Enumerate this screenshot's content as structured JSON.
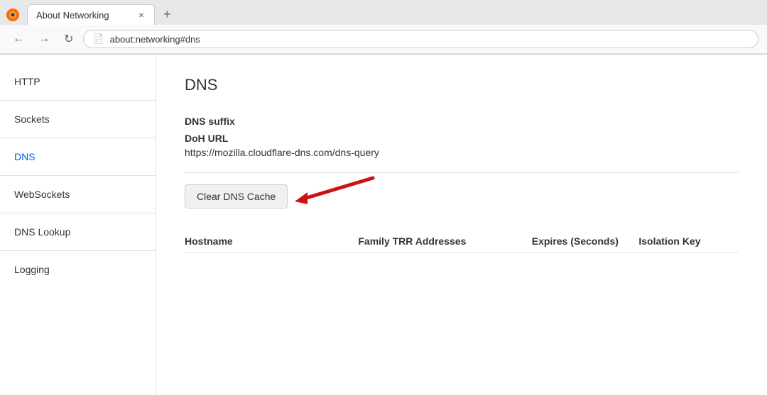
{
  "browser": {
    "tab_title": "About Networking",
    "address_url": "about:networking#dns",
    "address_icon": "🔒"
  },
  "nav": {
    "back_label": "←",
    "forward_label": "→",
    "reload_label": "↻",
    "new_tab_label": "+"
  },
  "sidebar": {
    "items": [
      {
        "id": "http",
        "label": "HTTP",
        "active": false
      },
      {
        "id": "sockets",
        "label": "Sockets",
        "active": false
      },
      {
        "id": "dns",
        "label": "DNS",
        "active": true
      },
      {
        "id": "websockets",
        "label": "WebSockets",
        "active": false
      },
      {
        "id": "dns-lookup",
        "label": "DNS Lookup",
        "active": false
      },
      {
        "id": "logging",
        "label": "Logging",
        "active": false
      }
    ]
  },
  "main": {
    "page_title": "DNS",
    "dns_suffix_label": "DNS suffix",
    "doh_url_label": "DoH URL",
    "doh_url_value": "https://mozilla.cloudflare-dns.com/dns-query",
    "clear_cache_btn": "Clear DNS Cache",
    "columns": {
      "hostname": "Hostname",
      "family_trr": "Family TRR Addresses",
      "expires": "Expires (Seconds)",
      "isolation_key": "Isolation Key"
    }
  }
}
